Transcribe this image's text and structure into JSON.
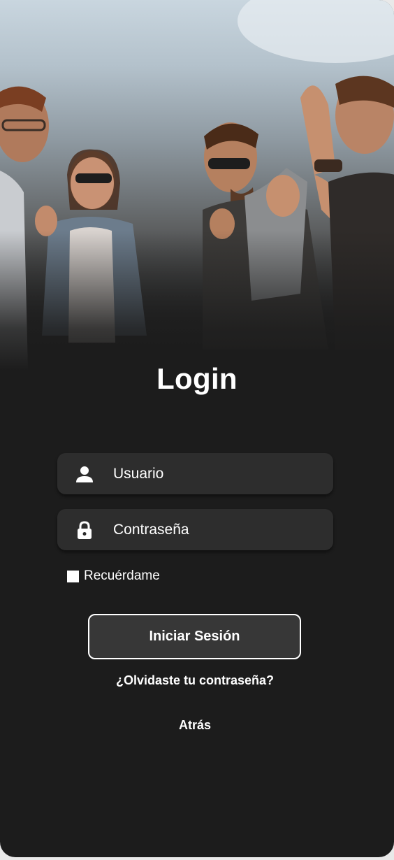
{
  "hero": {
    "photo_description_icon": "group-of-friends-photo"
  },
  "title": "Login",
  "username": {
    "icon": "person-icon",
    "placeholder": "Usuario",
    "value": ""
  },
  "password": {
    "icon": "lock-icon",
    "placeholder": "Contraseña",
    "value": ""
  },
  "remember": {
    "label": "Recuérdame",
    "checked": false
  },
  "login_button": "Iniciar Sesión",
  "forgot_link": "¿Olvidaste tu contraseña?",
  "back_link": "Atrás",
  "colors": {
    "background": "#1c1c1c",
    "field": "#2d2d2d",
    "button": "#373737",
    "text": "#ffffff"
  }
}
